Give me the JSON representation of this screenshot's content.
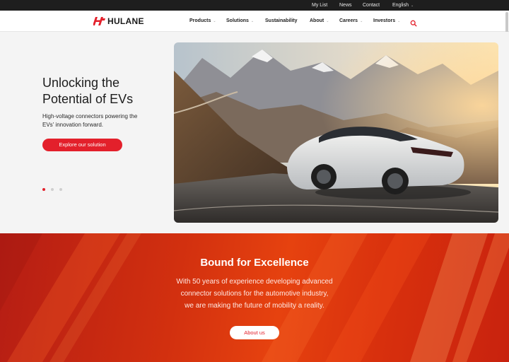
{
  "topbar": {
    "links": [
      "My List",
      "News",
      "Contact"
    ],
    "language": "English"
  },
  "brand": {
    "name": "HULANE",
    "accent": "#e3202b"
  },
  "nav": {
    "items": [
      {
        "label": "Products",
        "has_dropdown": true
      },
      {
        "label": "Solutions",
        "has_dropdown": true
      },
      {
        "label": "Sustainability",
        "has_dropdown": false
      },
      {
        "label": "About",
        "has_dropdown": true
      },
      {
        "label": "Careers",
        "has_dropdown": true
      },
      {
        "label": "Investors",
        "has_dropdown": true
      }
    ],
    "search_icon": "search-icon"
  },
  "hero": {
    "title_line1": "Unlocking the",
    "title_line2": "Potential of EVs",
    "subtitle_line1": "High-voltage connectors powering the",
    "subtitle_line2": "EVs' innovation forward.",
    "cta": "Explore our solution",
    "slides_total": 3,
    "active_slide": 1
  },
  "band": {
    "title": "Bound for Excellence",
    "text_line1": "With 50 years of experience developing advanced",
    "text_line2": "connector solutions for the automotive industry,",
    "text_line3": "we are making the future of mobility a reality.",
    "button": "About us"
  }
}
